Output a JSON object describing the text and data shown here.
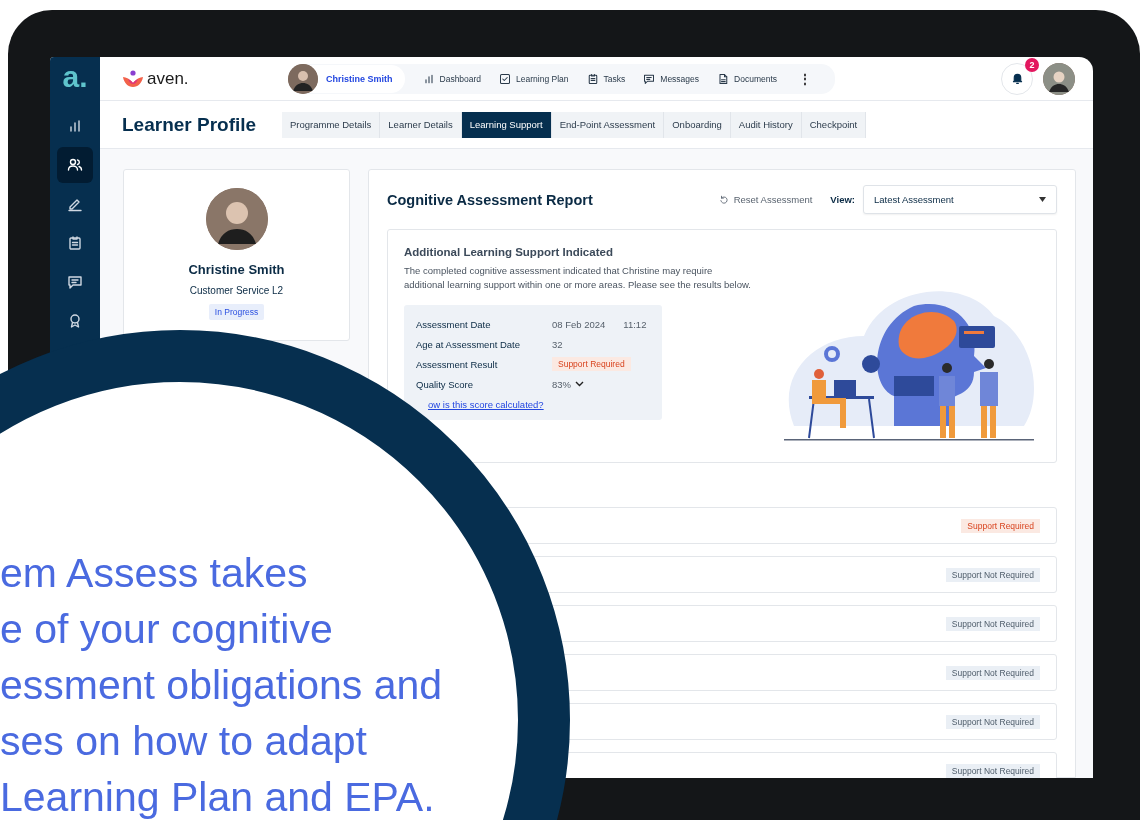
{
  "sidebar": {
    "logo": "a.",
    "items": [
      {
        "selected": false
      },
      {
        "selected": true
      },
      {
        "selected": false
      },
      {
        "selected": false
      },
      {
        "selected": false
      },
      {
        "selected": false
      }
    ]
  },
  "top_bar": {
    "brand": "aven.",
    "user": "Christine Smith",
    "nav": [
      {
        "label": "Dashboard"
      },
      {
        "label": "Learning Plan"
      },
      {
        "label": "Tasks"
      },
      {
        "label": "Messages"
      },
      {
        "label": "Documents"
      }
    ],
    "more": "⋮",
    "notifications": "2"
  },
  "page": {
    "title": "Learner Profile",
    "tabs": [
      {
        "label": "Programme Details",
        "selected": false
      },
      {
        "label": "Learner Details",
        "selected": false
      },
      {
        "label": "Learning Support",
        "selected": true
      },
      {
        "label": "End-Point Assessment",
        "selected": false
      },
      {
        "label": "Onboarding",
        "selected": false
      },
      {
        "label": "Audit History",
        "selected": false
      },
      {
        "label": "Checkpoint",
        "selected": false
      }
    ]
  },
  "profile": {
    "name": "Christine Smith",
    "course": "Customer Service L2",
    "status": "In Progress"
  },
  "report": {
    "title": "Cognitive Assessment Report",
    "reset": "Reset Assessment",
    "view_label": "View:",
    "view_value": "Latest Assessment",
    "summary": {
      "title": "Additional Learning Support Indicated",
      "text": "The completed cognitive assessment indicated that Christine may require additional learning support within one or more areas. Please see the results below.",
      "details": [
        {
          "kind": "datetime",
          "label": "Assessment Date",
          "value": "08 Feb 2024",
          "time": "11:12"
        },
        {
          "kind": "text",
          "label": "Age at Assessment Date",
          "value": "32"
        },
        {
          "kind": "badge",
          "label": "Assessment Result",
          "value": "Support Required"
        },
        {
          "kind": "dropdown",
          "label": "Quality Score",
          "value": "83%"
        }
      ],
      "link": "ow is this score calculated?"
    },
    "results": [
      {
        "kind": "required",
        "status": "Support Required"
      },
      {
        "kind": "not_required",
        "status": "Support Not Required"
      },
      {
        "kind": "not_required",
        "status": "Support Not Required"
      },
      {
        "kind": "not_required",
        "status": "Support Not Required"
      },
      {
        "kind": "not_required",
        "status": "Support Not Required"
      },
      {
        "kind": "not_required",
        "status": "Support Not Required"
      }
    ]
  },
  "promo": {
    "lines": [
      "em Assess takes",
      "e of your cognitive",
      "essment obligations and",
      "ses on how to adapt",
      "Learning Plan and EPA."
    ]
  }
}
